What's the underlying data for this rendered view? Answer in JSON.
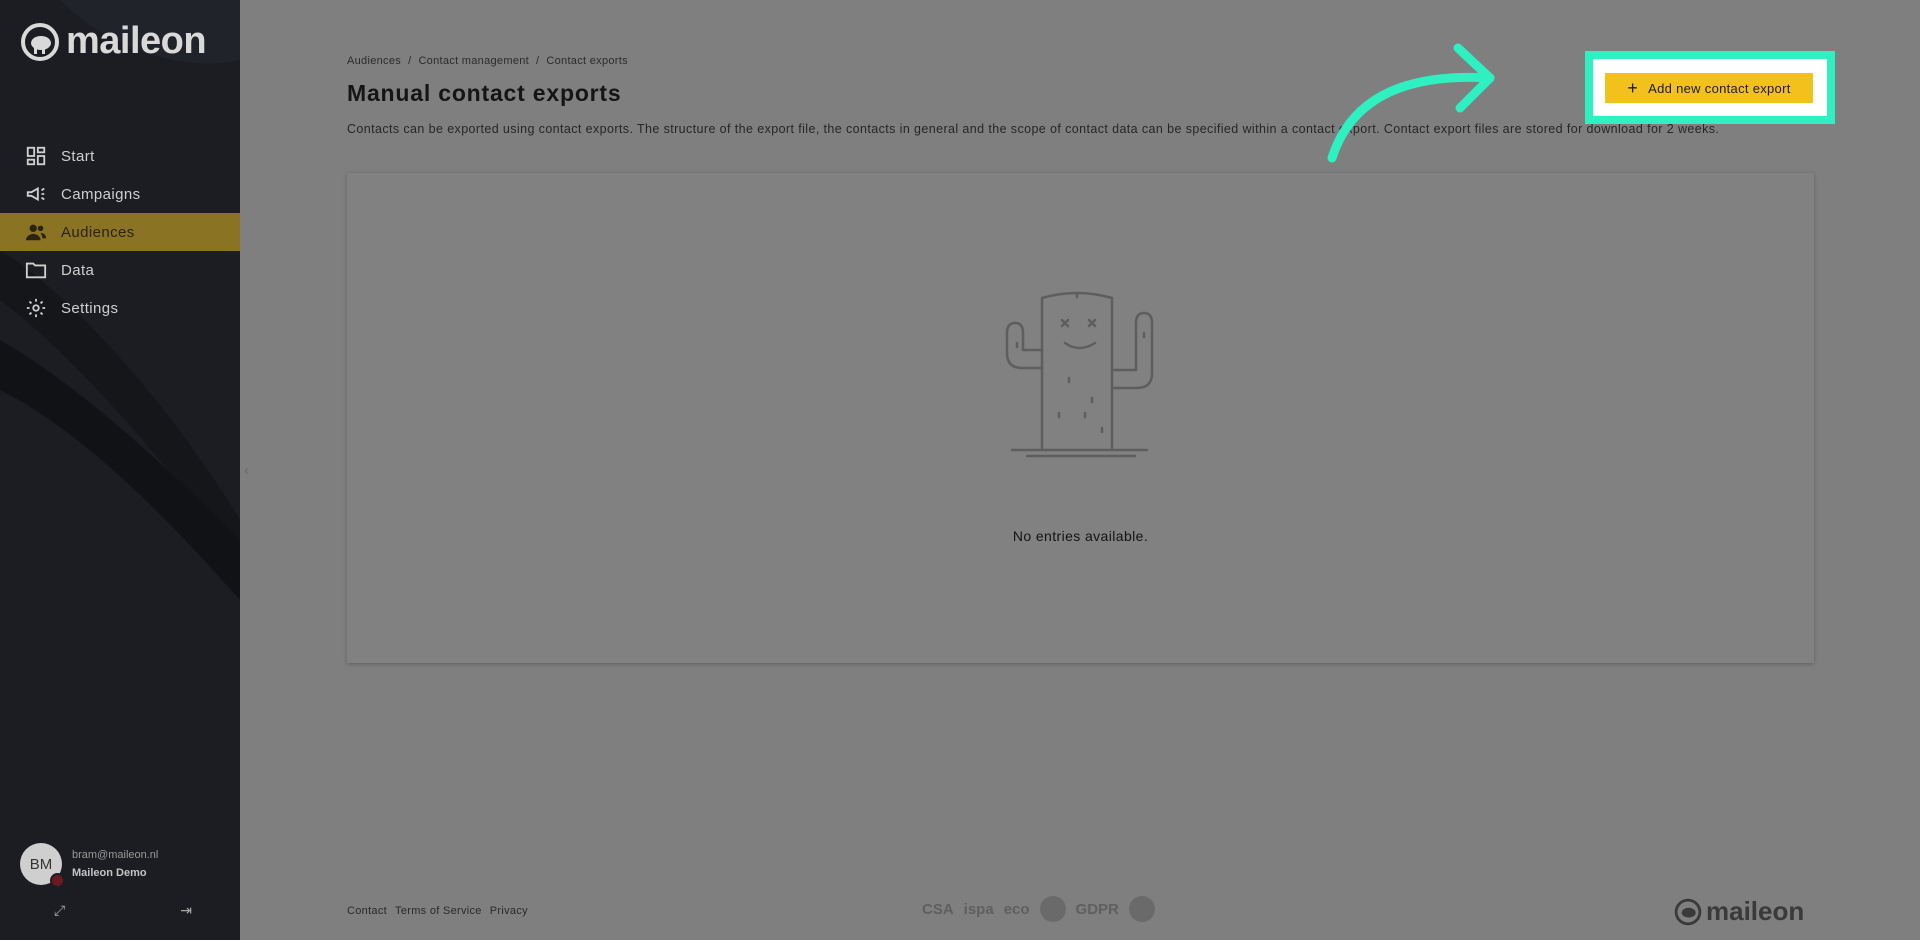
{
  "sidebar": {
    "logo_text": "maileon",
    "items": [
      {
        "label": "Start",
        "icon": "dashboard-icon"
      },
      {
        "label": "Campaigns",
        "icon": "megaphone-icon"
      },
      {
        "label": "Audiences",
        "icon": "people-icon",
        "active": true
      },
      {
        "label": "Data",
        "icon": "folder-icon"
      },
      {
        "label": "Settings",
        "icon": "gear-icon"
      }
    ],
    "user": {
      "initials": "BM",
      "email": "bram@maileon.nl",
      "org": "Maileon Demo"
    }
  },
  "breadcrumb": [
    "Audiences",
    "Contact management",
    "Contact exports"
  ],
  "breadcrumb_sep": "/",
  "page": {
    "title": "Manual contact exports",
    "description": "Contacts can be exported using contact exports. The structure of the export file, the contacts in general and the scope of contact data can be specified within a contact export. Contact export files are stored for download for 2 weeks.",
    "add_button": "Add new contact export",
    "empty_text": "No entries available."
  },
  "footer": {
    "links": [
      "Contact",
      "Terms of Service",
      "Privacy"
    ],
    "badges": [
      "CSA",
      "ispa",
      "eco",
      "GDPR"
    ],
    "logo_text": "maileon"
  },
  "colors": {
    "accent": "#f2c11c",
    "highlight": "#2ff0c0",
    "sidebar_bg": "#1b1d22"
  }
}
